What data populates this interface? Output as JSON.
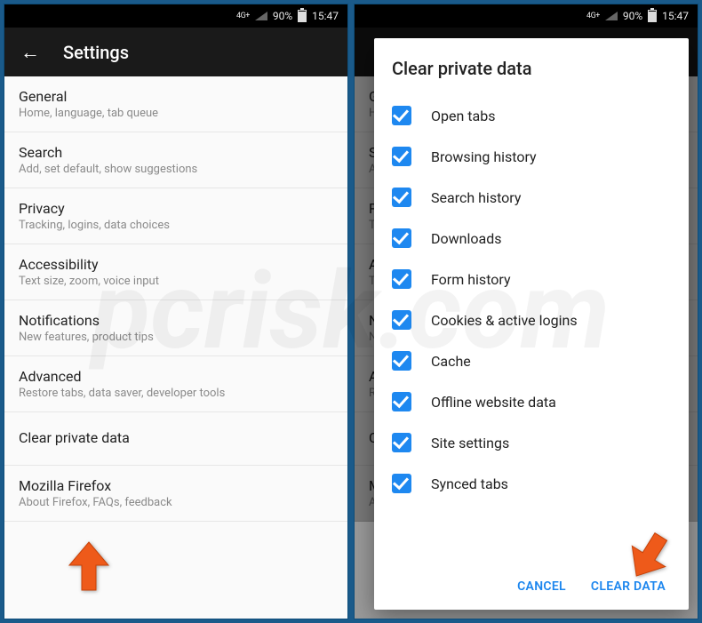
{
  "status": {
    "network": "4G+",
    "battery_pct": "90%",
    "time": "15:47"
  },
  "left": {
    "header": {
      "title": "Settings"
    },
    "items": [
      {
        "label": "General",
        "desc": "Home, language, tab queue"
      },
      {
        "label": "Search",
        "desc": "Add, set default, show suggestions"
      },
      {
        "label": "Privacy",
        "desc": "Tracking, logins, data choices"
      },
      {
        "label": "Accessibility",
        "desc": "Text size, zoom, voice input"
      },
      {
        "label": "Notifications",
        "desc": "New features, product tips"
      },
      {
        "label": "Advanced",
        "desc": "Restore tabs, data saver, developer tools"
      },
      {
        "label": "Clear private data",
        "desc": ""
      },
      {
        "label": "Mozilla Firefox",
        "desc": "About Firefox, FAQs, feedback"
      }
    ]
  },
  "right": {
    "bg_items": [
      {
        "label": "G",
        "desc": "H"
      },
      {
        "label": "S",
        "desc": "A"
      },
      {
        "label": "P",
        "desc": "T"
      },
      {
        "label": "A",
        "desc": "T"
      },
      {
        "label": "N",
        "desc": "N"
      },
      {
        "label": "A",
        "desc": "R"
      },
      {
        "label": "C",
        "desc": ""
      },
      {
        "label": "M",
        "desc": "A"
      }
    ],
    "dialog": {
      "title": "Clear private data",
      "options": [
        "Open tabs",
        "Browsing history",
        "Search history",
        "Downloads",
        "Form history",
        "Cookies & active logins",
        "Cache",
        "Offline website data",
        "Site settings",
        "Synced tabs"
      ],
      "cancel": "CANCEL",
      "confirm": "CLEAR DATA"
    }
  },
  "colors": {
    "accent": "#1e88f0",
    "arrow": "#ee5a1a"
  }
}
